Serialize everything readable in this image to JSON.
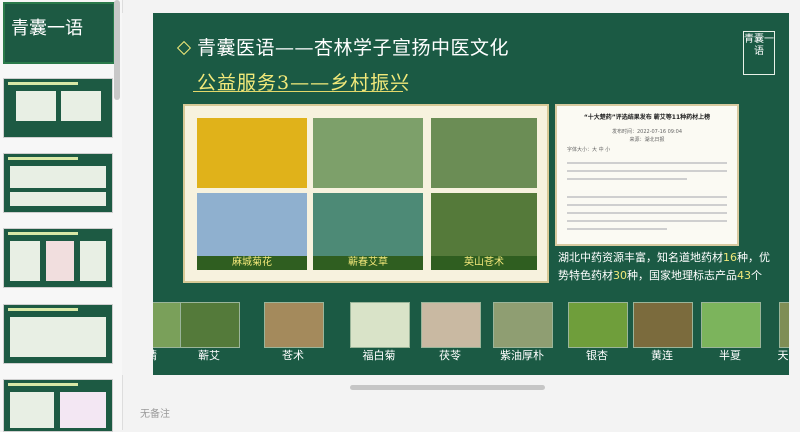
{
  "thumbnails": [
    {
      "title": "青囊一语"
    },
    {
      "title": ""
    },
    {
      "title": ""
    },
    {
      "title": ""
    },
    {
      "title": ""
    },
    {
      "title": ""
    }
  ],
  "slide": {
    "title_line1": "青囊医语——杏林学子宣扬中医文化",
    "title_line2": "公益服务3——乡村振兴",
    "logo_text": "青囊一语",
    "photo_captions": [
      "麻城菊花",
      "蕲春艾草",
      "英山苍术"
    ],
    "news": {
      "headline": "“十大楚药”评选结果发布 蕲艾等11种药材上榜",
      "date": "发布时间：2022-07-16 09:04",
      "source": "来源：湖北日报",
      "font_size_label": "字体大小：大 中 小"
    },
    "description_parts": [
      "湖北中药资源丰富，知名道地药材",
      "16",
      "种，优势特色药材",
      "30",
      "种，国家地理标志产品",
      "43",
      "个"
    ],
    "herbs": [
      "黄精",
      "蕲艾",
      "苍术",
      "福白菊",
      "茯苓",
      "紫油厚朴",
      "银杏",
      "黄连",
      "半夏",
      "天"
    ]
  },
  "notes_placeholder": "无备注",
  "colors": {
    "slide_bg": "#1b5a44",
    "accent": "#f2e97a"
  }
}
